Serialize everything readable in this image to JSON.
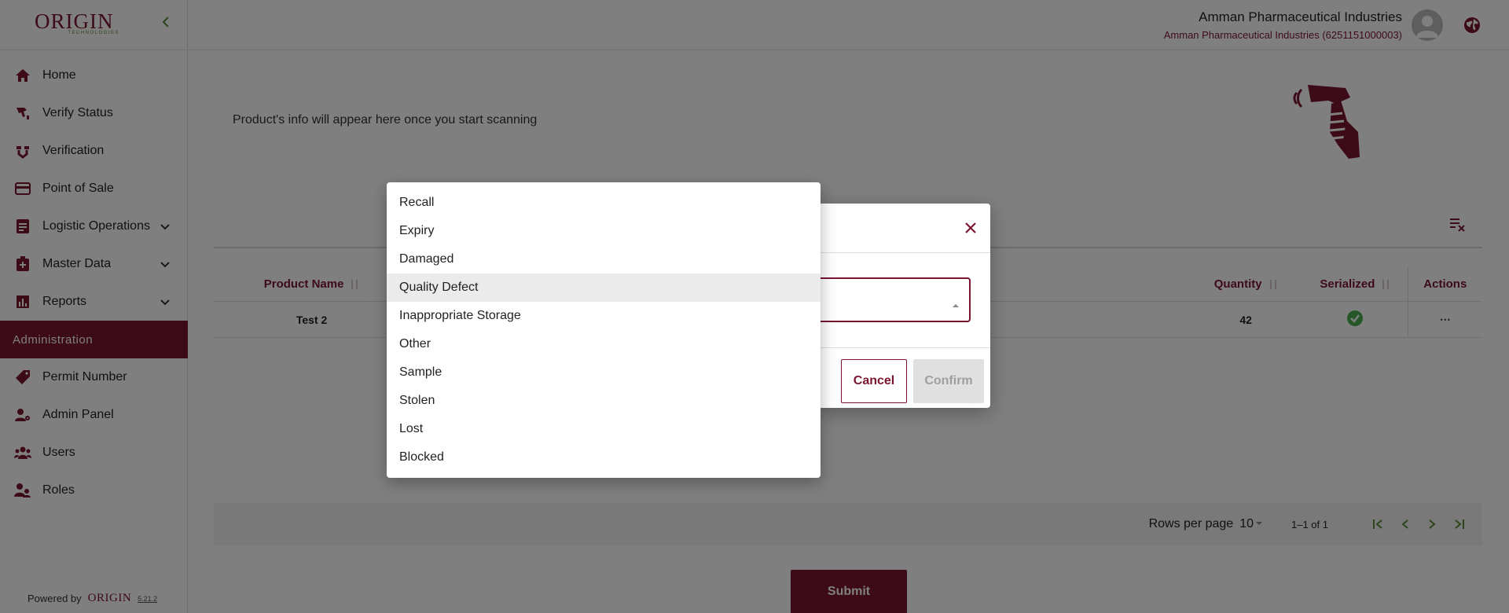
{
  "app": {
    "logo_text": "ORIGIN",
    "logo_subtext": "TECHNOLOGIES",
    "company_name": "Amman Pharmaceutical Industries",
    "company_sub": "Amman Pharmaceutical Industries (6251151000003)",
    "accent_color": "#7a1530"
  },
  "sidebar": {
    "items": [
      {
        "label": "Home",
        "icon": "home-icon"
      },
      {
        "label": "Verify Status",
        "icon": "verify-status-icon"
      },
      {
        "label": "Verification",
        "icon": "verification-icon"
      },
      {
        "label": "Point of Sale",
        "icon": "card-icon"
      },
      {
        "label": "Logistic Operations",
        "icon": "clipboard-icon"
      },
      {
        "label": "Master Data",
        "icon": "medical-box-icon"
      },
      {
        "label": "Reports",
        "icon": "chart-icon"
      }
    ],
    "section_label": "Administration",
    "admin_items": [
      {
        "label": "Permit Number",
        "icon": "tag-icon"
      },
      {
        "label": "Admin Panel",
        "icon": "user-gear-icon"
      },
      {
        "label": "Users",
        "icon": "users-icon"
      },
      {
        "label": "Roles",
        "icon": "roles-icon"
      }
    ],
    "powered_by": "Powered by",
    "powered_logo": "ORIGIN",
    "version": "5.21.2"
  },
  "main": {
    "scan_message": "Product's info will appear here once you start scanning",
    "table": {
      "headers": [
        "Product Name",
        "Quantity",
        "Serialized",
        "Actions"
      ],
      "rows": [
        {
          "product_name": "Test 2",
          "quantity": "42",
          "serialized": true,
          "actions": "⋯"
        }
      ]
    },
    "pagination": {
      "rows_per_page_label": "Rows per page",
      "rows_per_page": "10",
      "range": "1–1 of 1"
    },
    "submit_label": "Submit"
  },
  "dialog": {
    "cancel_label": "Cancel",
    "confirm_label": "Confirm"
  },
  "dropdown": {
    "options": [
      "Recall",
      "Expiry",
      "Damaged",
      "Quality Defect",
      "Inappropriate Storage",
      "Other",
      "Sample",
      "Stolen",
      "Lost",
      "Blocked"
    ],
    "highlighted": "Quality Defect"
  }
}
